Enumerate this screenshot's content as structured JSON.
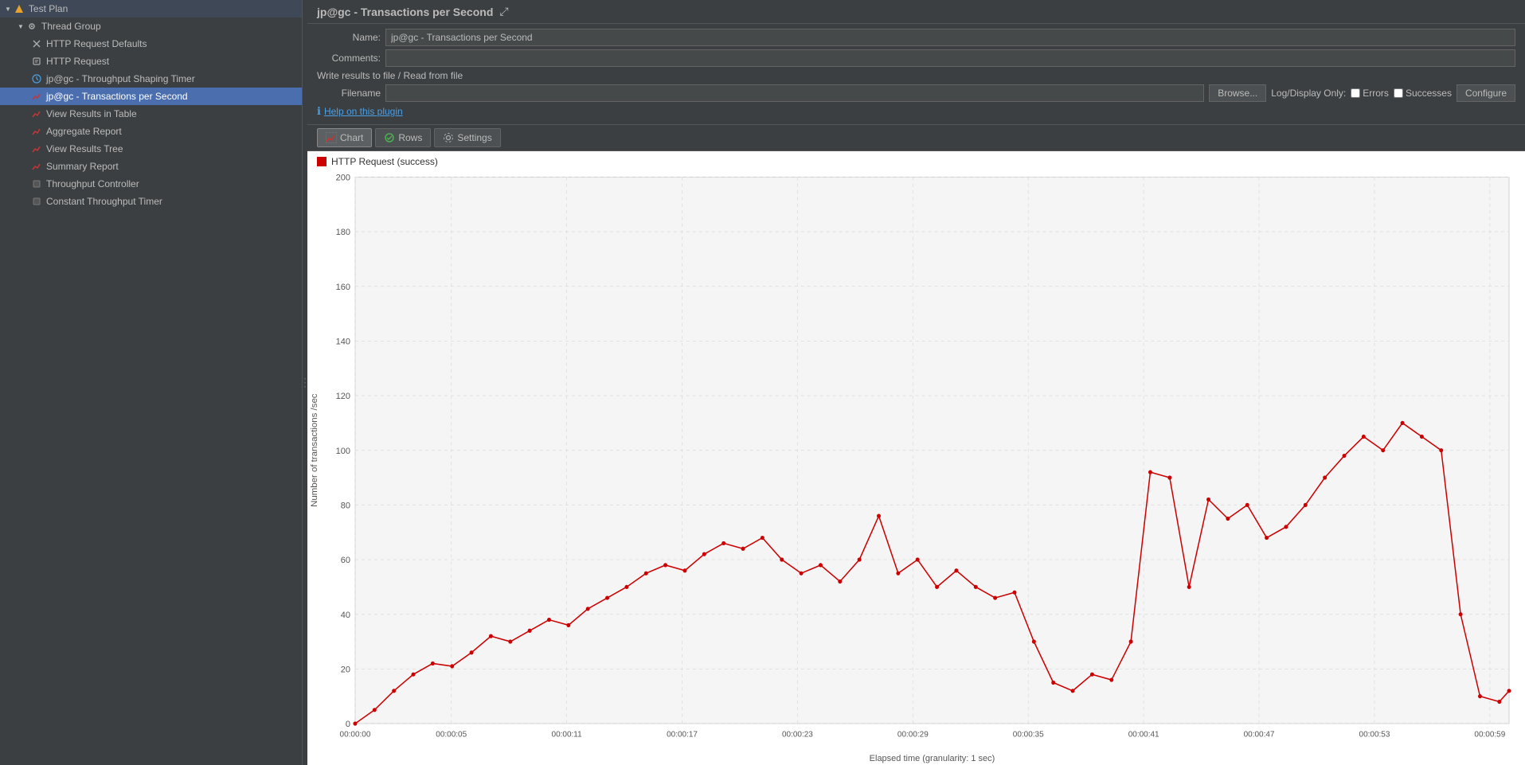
{
  "sidebar": {
    "items": [
      {
        "id": "test-plan",
        "label": "Test Plan",
        "depth": 0,
        "icon": "triangle",
        "iconColor": "#e8a22a",
        "expanded": true,
        "selected": false
      },
      {
        "id": "thread-group",
        "label": "Thread Group",
        "depth": 1,
        "icon": "gear",
        "iconColor": "#aaa",
        "expanded": true,
        "selected": false
      },
      {
        "id": "http-defaults",
        "label": "HTTP Request Defaults",
        "depth": 2,
        "icon": "x",
        "iconColor": "#aaa",
        "selected": false
      },
      {
        "id": "http-request",
        "label": "HTTP Request",
        "depth": 2,
        "icon": "pencil",
        "iconColor": "#aaa",
        "selected": false
      },
      {
        "id": "throughput-timer",
        "label": "jp@gc - Throughput Shaping Timer",
        "depth": 2,
        "icon": "clock",
        "iconColor": "#4b9fe5",
        "selected": false
      },
      {
        "id": "tps",
        "label": "jp@gc - Transactions per Second",
        "depth": 2,
        "icon": "chart",
        "iconColor": "#cc3333",
        "selected": true
      },
      {
        "id": "view-results-table",
        "label": "View Results in Table",
        "depth": 2,
        "icon": "chart",
        "iconColor": "#cc3333",
        "selected": false
      },
      {
        "id": "aggregate-report",
        "label": "Aggregate Report",
        "depth": 2,
        "icon": "chart",
        "iconColor": "#cc3333",
        "selected": false
      },
      {
        "id": "view-results-tree",
        "label": "View Results Tree",
        "depth": 2,
        "icon": "chart",
        "iconColor": "#cc3333",
        "selected": false
      },
      {
        "id": "summary-report",
        "label": "Summary Report",
        "depth": 2,
        "icon": "chart",
        "iconColor": "#cc3333",
        "selected": false
      },
      {
        "id": "throughput-controller",
        "label": "Throughput Controller",
        "depth": 2,
        "icon": "gear-gray",
        "iconColor": "#777",
        "selected": false
      },
      {
        "id": "constant-timer",
        "label": "Constant Throughput Timer",
        "depth": 2,
        "icon": "gear-gray",
        "iconColor": "#777",
        "selected": false
      }
    ]
  },
  "main": {
    "title": "jp@gc - Transactions per Second",
    "name_label": "Name:",
    "name_value": "jp@gc - Transactions per Second",
    "comments_label": "Comments:",
    "comments_value": "",
    "write_results_label": "Write results to file / Read from file",
    "filename_label": "Filename",
    "filename_value": "",
    "browse_label": "Browse...",
    "log_display_label": "Log/Display Only:",
    "errors_label": "Errors",
    "successes_label": "Successes",
    "configure_label": "Configure",
    "help_text": "Help on this plugin",
    "tabs": [
      {
        "id": "chart",
        "label": "Chart",
        "active": true
      },
      {
        "id": "rows",
        "label": "Rows",
        "active": false
      },
      {
        "id": "settings",
        "label": "Settings",
        "active": false
      }
    ],
    "chart": {
      "legend_label": "HTTP Request (success)",
      "y_axis_label": "Number of transactions /sec",
      "x_axis_label": "Elapsed time (granularity: 1 sec)",
      "y_ticks": [
        0,
        20,
        40,
        60,
        80,
        100,
        120,
        140,
        160,
        180,
        200
      ],
      "x_ticks": [
        "00:00:00",
        "00:00:05",
        "00:00:11",
        "00:00:17",
        "00:00:23",
        "00:00:29",
        "00:00:35",
        "00:00:41",
        "00:00:47",
        "00:00:53",
        "00:00:59"
      ],
      "data_points": [
        {
          "x": 0,
          "y": 0
        },
        {
          "x": 2,
          "y": 5
        },
        {
          "x": 4,
          "y": 12
        },
        {
          "x": 6,
          "y": 18
        },
        {
          "x": 8,
          "y": 22
        },
        {
          "x": 10,
          "y": 21
        },
        {
          "x": 12,
          "y": 26
        },
        {
          "x": 14,
          "y": 32
        },
        {
          "x": 16,
          "y": 30
        },
        {
          "x": 18,
          "y": 34
        },
        {
          "x": 20,
          "y": 38
        },
        {
          "x": 22,
          "y": 36
        },
        {
          "x": 24,
          "y": 42
        },
        {
          "x": 26,
          "y": 46
        },
        {
          "x": 28,
          "y": 50
        },
        {
          "x": 30,
          "y": 55
        },
        {
          "x": 32,
          "y": 58
        },
        {
          "x": 34,
          "y": 56
        },
        {
          "x": 36,
          "y": 62
        },
        {
          "x": 38,
          "y": 66
        },
        {
          "x": 40,
          "y": 64
        },
        {
          "x": 42,
          "y": 68
        },
        {
          "x": 44,
          "y": 60
        },
        {
          "x": 46,
          "y": 55
        },
        {
          "x": 48,
          "y": 58
        },
        {
          "x": 50,
          "y": 52
        },
        {
          "x": 52,
          "y": 60
        },
        {
          "x": 54,
          "y": 76
        },
        {
          "x": 56,
          "y": 55
        },
        {
          "x": 58,
          "y": 60
        },
        {
          "x": 60,
          "y": 50
        },
        {
          "x": 62,
          "y": 56
        },
        {
          "x": 64,
          "y": 50
        },
        {
          "x": 66,
          "y": 46
        },
        {
          "x": 68,
          "y": 48
        },
        {
          "x": 70,
          "y": 30
        },
        {
          "x": 72,
          "y": 15
        },
        {
          "x": 74,
          "y": 12
        },
        {
          "x": 76,
          "y": 18
        },
        {
          "x": 78,
          "y": 16
        },
        {
          "x": 80,
          "y": 30
        },
        {
          "x": 82,
          "y": 92
        },
        {
          "x": 84,
          "y": 90
        },
        {
          "x": 86,
          "y": 50
        },
        {
          "x": 88,
          "y": 82
        },
        {
          "x": 90,
          "y": 75
        },
        {
          "x": 92,
          "y": 80
        },
        {
          "x": 94,
          "y": 68
        },
        {
          "x": 96,
          "y": 72
        },
        {
          "x": 98,
          "y": 80
        },
        {
          "x": 100,
          "y": 90
        },
        {
          "x": 102,
          "y": 98
        },
        {
          "x": 104,
          "y": 105
        },
        {
          "x": 106,
          "y": 100
        },
        {
          "x": 108,
          "y": 110
        },
        {
          "x": 110,
          "y": 105
        },
        {
          "x": 112,
          "y": 100
        },
        {
          "x": 114,
          "y": 40
        },
        {
          "x": 116,
          "y": 10
        },
        {
          "x": 118,
          "y": 8
        },
        {
          "x": 119,
          "y": 12
        }
      ],
      "x_max": 119,
      "y_max": 200
    }
  },
  "colors": {
    "sidebar_bg": "#3c3f41",
    "main_bg": "#2b2b2b",
    "selected_bg": "#4b6eaf",
    "chart_line": "#cc0000",
    "chart_bg": "#f5f5f5",
    "grid_line": "#dddddd"
  }
}
